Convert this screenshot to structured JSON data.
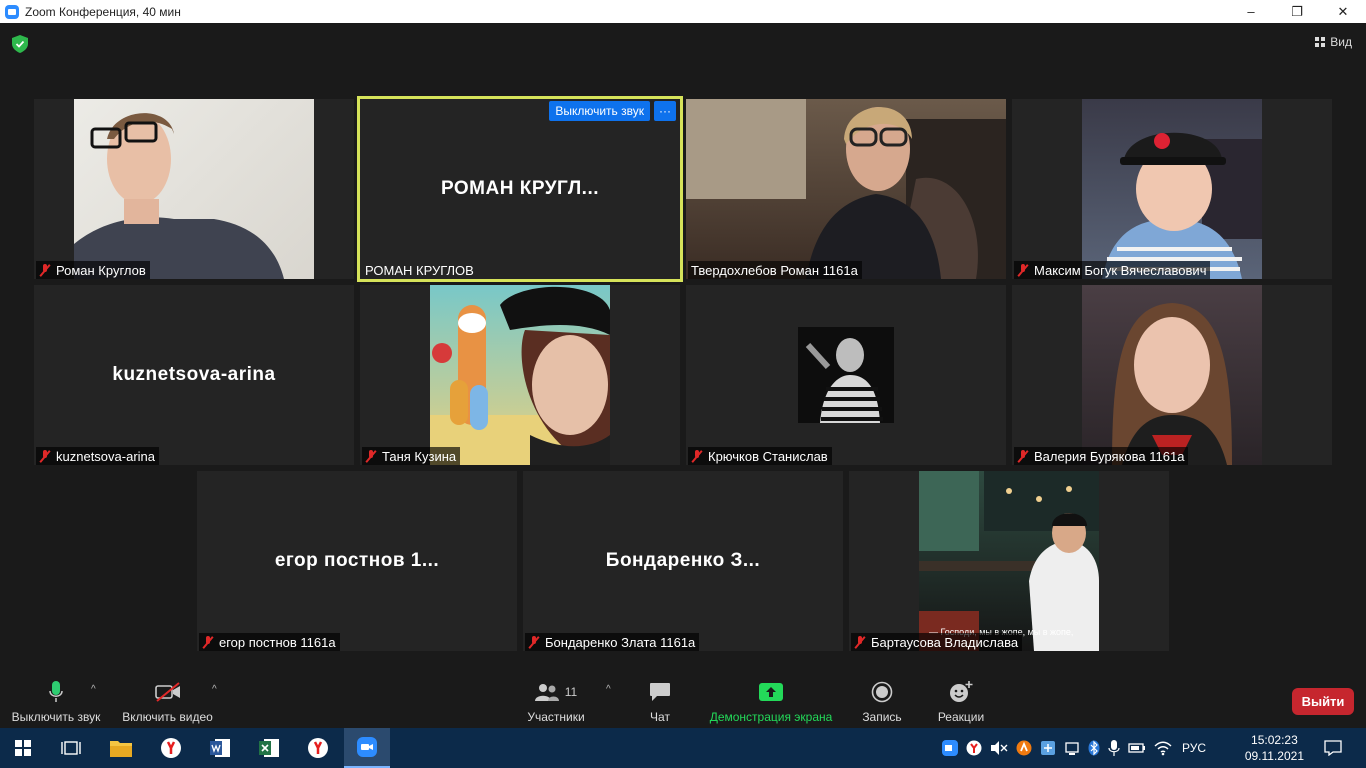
{
  "window": {
    "title": "Zoom Конференция, 40 мин",
    "minimize": "–",
    "maximize": "❐",
    "close": "✕"
  },
  "topbar": {
    "view_label": "Вид"
  },
  "tiles": [
    {
      "name": "Роман Круглов",
      "big": ""
    },
    {
      "name": "РОМАН КРУГЛОВ",
      "big": "РОМАН  КРУГЛ...",
      "unmute": "Выключить звук",
      "more": "···"
    },
    {
      "name": "Твердохлебов Роман 1161а",
      "big": ""
    },
    {
      "name": "Максим Богук Вячеславович",
      "big": ""
    },
    {
      "name": "kuznetsova-arina",
      "big": "kuznetsova-arina"
    },
    {
      "name": "Таня Кузина",
      "big": ""
    },
    {
      "name": "Крючков Станислав",
      "big": ""
    },
    {
      "name": "Валерия Бурякова 1161а",
      "big": ""
    },
    {
      "name": "егор постнов 1161а",
      "big": "егор  постнов  1..."
    },
    {
      "name": "Бондаренко Злата 1161а",
      "big": "Бондаренко  З..."
    },
    {
      "name": "Бартаусова Владислава",
      "big": "",
      "caption": "— Господи, мы в жопе, мы в жопе,"
    }
  ],
  "toolbar": {
    "mute": "Выключить звук",
    "video": "Включить видео",
    "participants": "Участники",
    "participants_count": "11",
    "chat": "Чат",
    "share": "Демонстрация экрана",
    "record": "Запись",
    "reactions": "Реакции",
    "leave": "Выйти"
  },
  "taskbar": {
    "lang": "РУС",
    "time": "15:02:23",
    "date": "09.11.2021"
  },
  "colors": {
    "active_speaker": "#d6e35a",
    "share_green": "#23d959",
    "leave_red": "#c6262e",
    "zoom_blue": "#0e72ed"
  }
}
